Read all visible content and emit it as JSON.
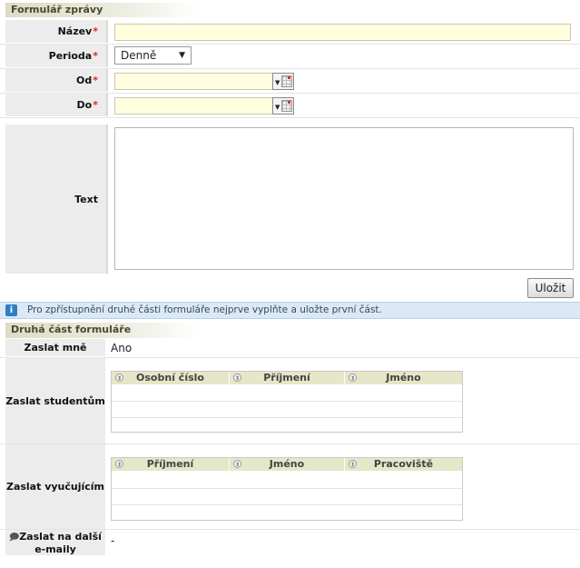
{
  "form": {
    "title": "Formulář zprávy",
    "fields": {
      "name_label": "Název",
      "name_value": "",
      "period_label": "Perioda",
      "period_value": "Denně",
      "from_label": "Od",
      "from_value": "",
      "to_label": "Do",
      "to_value": "",
      "text_label": "Text",
      "text_value": ""
    },
    "required_mark": "*",
    "save_label": "Uložit"
  },
  "info": {
    "icon": "info-icon",
    "text": "Pro zpřístupnění druhé části formuláře nejprve vyplňte a uložte první část."
  },
  "second": {
    "title": "Druhá část formuláře",
    "send_me_label": "Zaslat mně",
    "send_me_value": "Ano",
    "students_label": "Zaslat studentům",
    "students_columns": [
      "Osobní číslo",
      "Příjmení",
      "Jméno"
    ],
    "teachers_label": "Zaslat vyučujícím",
    "teachers_columns": [
      "Příjmení",
      "Jméno",
      "Pracoviště"
    ],
    "other_emails_label": "Zaslat na další e-maily",
    "other_emails_icon": "comment-icon",
    "other_emails_value": "-"
  }
}
